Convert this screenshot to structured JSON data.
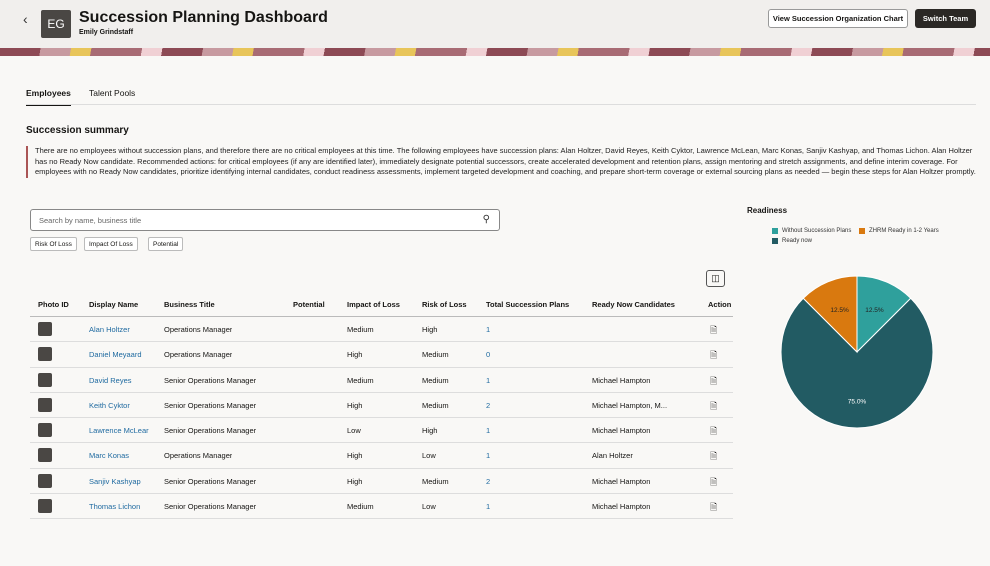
{
  "header": {
    "back_icon": "chevron-left-icon",
    "avatar_initials": "EG",
    "title": "Succession Planning Dashboard",
    "subtitle": "Emily Grindstaff",
    "view_chart_label": "View Succession Organization Chart",
    "switch_team_label": "Switch Team"
  },
  "tabs": [
    {
      "label": "Employees",
      "active": true
    },
    {
      "label": "Talent Pools",
      "active": false
    }
  ],
  "summary": {
    "heading": "Succession summary",
    "text": "There are no employees without succession plans, and therefore there are no critical employees at this time. The following employees have succession plans: Alan Holtzer, David Reyes, Keith Cyktor, Lawrence McLean, Marc Konas, Sanjiv Kashyap, and Thomas Lichon. Alan Holtzer has no Ready Now candidate. Recommended actions: for critical employees (if any are identified later), immediately designate potential successors, create accelerated development and retention plans, assign mentoring and stretch assignments, and define interim coverage. For employees with no Ready Now candidates, prioritize identifying internal candidates, conduct readiness assessments, implement targeted development and coaching, and prepare short-term coverage or external sourcing plans as needed — begin these steps for Alan Holtzer promptly."
  },
  "search": {
    "placeholder": "Search by name, business title",
    "icon": "search-icon"
  },
  "filters": [
    "Risk Of Loss",
    "Impact Of Loss",
    "Potential"
  ],
  "table": {
    "columns": [
      "Photo ID",
      "Display Name",
      "Business Title",
      "Potential",
      "Impact of Loss",
      "Risk of Loss",
      "Total Succession Plans",
      "Ready Now Candidates",
      "Action"
    ],
    "rows": [
      {
        "name": "Alan Holtzer",
        "title": "Operations Manager",
        "potential": "",
        "impact": "Medium",
        "risk": "High",
        "plans": "1",
        "ready": ""
      },
      {
        "name": "Daniel Meyaard",
        "title": "Operations Manager",
        "potential": "",
        "impact": "High",
        "risk": "Medium",
        "plans": "0",
        "ready": ""
      },
      {
        "name": "David Reyes",
        "title": "Senior Operations Manager",
        "potential": "",
        "impact": "Medium",
        "risk": "Medium",
        "plans": "1",
        "ready": "Michael Hampton"
      },
      {
        "name": "Keith Cyktor",
        "title": "Senior Operations Manager",
        "potential": "",
        "impact": "High",
        "risk": "Medium",
        "plans": "2",
        "ready": "Michael Hampton, M..."
      },
      {
        "name": "Lawrence McLear",
        "title": "Senior Operations Manager",
        "potential": "",
        "impact": "Low",
        "risk": "High",
        "plans": "1",
        "ready": "Michael Hampton"
      },
      {
        "name": "Marc Konas",
        "title": "Operations Manager",
        "potential": "",
        "impact": "High",
        "risk": "Low",
        "plans": "1",
        "ready": "Alan Holtzer"
      },
      {
        "name": "Sanjiv Kashyap",
        "title": "Senior Operations Manager",
        "potential": "",
        "impact": "High",
        "risk": "Medium",
        "plans": "2",
        "ready": "Michael Hampton"
      },
      {
        "name": "Thomas Lichon",
        "title": "Senior Operations Manager",
        "potential": "",
        "impact": "Medium",
        "risk": "Low",
        "plans": "1",
        "ready": "Michael Hampton"
      }
    ]
  },
  "chart_data": {
    "type": "pie",
    "title": "Readiness",
    "legend_placement": "top",
    "slices": [
      {
        "label": "Without Succession Plans",
        "value": 12.5,
        "display": "12.5%",
        "color": "#2fa09c"
      },
      {
        "label": "Ready now",
        "value": 75.0,
        "display": "75.0%",
        "color": "#225b63"
      },
      {
        "label": "ZHRM Ready in 1-2 Years",
        "value": 12.5,
        "display": "12.5%",
        "color": "#d9790f"
      }
    ],
    "legend_order": [
      "Without Succession Plans",
      "ZHRM Ready in 1-2 Years",
      "Ready now"
    ]
  }
}
